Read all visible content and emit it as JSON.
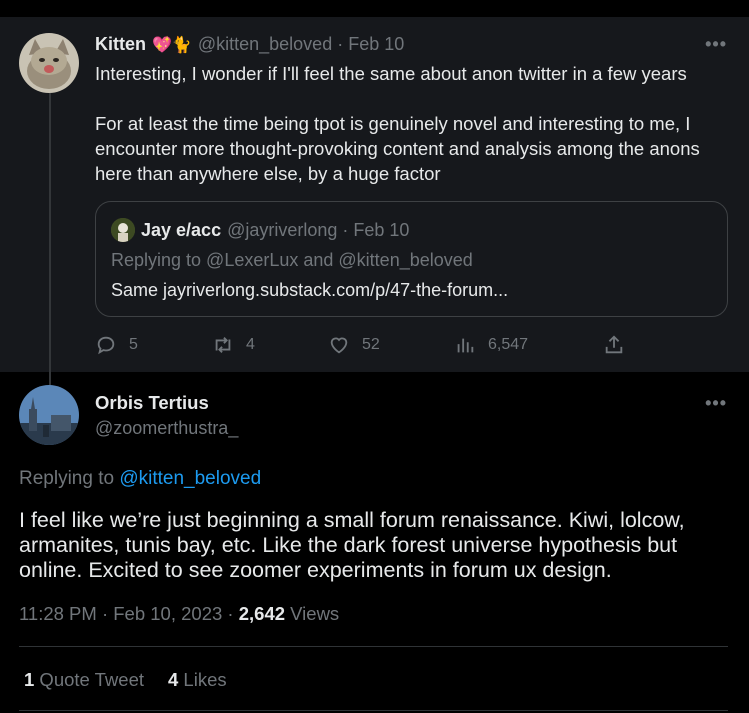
{
  "parent": {
    "display_name": "Kitten",
    "emojis": "💖🐈",
    "handle": "@kitten_beloved",
    "date": "· Feb 10",
    "more": "•••",
    "paragraph1": "Interesting, I wonder if I'll feel the same about anon twitter in a few years",
    "paragraph2": "For at least the time being tpot is genuinely novel and interesting to me, I encounter more thought-provoking content and analysis among the anons here than anywhere else, by a huge factor",
    "quote": {
      "display_name": "Jay e/acc",
      "handle": "@jayriverlong",
      "date": "· Feb 10",
      "replying": "Replying to @LexerLux and @kitten_beloved",
      "text": "Same jayriverlong.substack.com/p/47-the-forum..."
    },
    "actions": {
      "replies": "5",
      "retweets": "4",
      "likes": "52",
      "views": "6,547"
    }
  },
  "main": {
    "display_name": "Orbis Tertius",
    "handle": "@zoomerthustra_",
    "more": "•••",
    "replying_prefix": "Replying to",
    "replying_handle": "@kitten_beloved",
    "text": "I feel like we’re just beginning a small forum renaissance. Kiwi, lolcow, armanites, tunis bay, etc. Like the dark forest universe hypothesis but online. Excited to see zoomer experiments in forum ux design.",
    "timestamp": "11:28 PM · Feb 10, 2023 · ",
    "views_count": "2,642",
    "views_label": " Views",
    "quote_tweets_count": "1",
    "quote_tweets_label": " Quote Tweet",
    "likes_count": "4",
    "likes_label": " Likes"
  },
  "colors": {
    "background": "#000000",
    "card": "#16181c",
    "text": "#e7e9ea",
    "muted": "#71767b",
    "link": "#1d9bf0",
    "border": "#2f3336"
  }
}
